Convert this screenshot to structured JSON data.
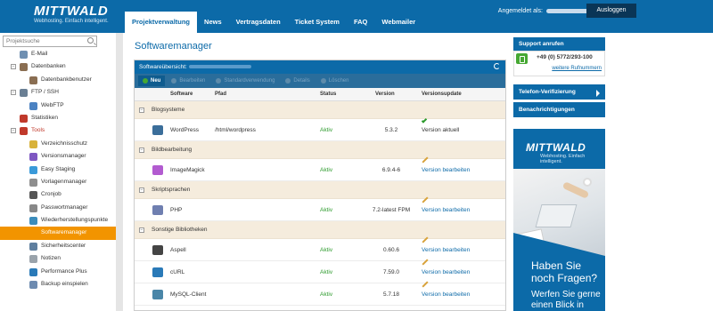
{
  "brand": {
    "name": "MITTWALD",
    "tagline": "Webhosting. Einfach intelligent."
  },
  "nav": {
    "items": [
      "Projektverwaltung",
      "News",
      "Vertragsdaten",
      "Ticket System",
      "FAQ",
      "Webmailer"
    ],
    "active": "Projektverwaltung"
  },
  "user": {
    "prefix": "Angemeldet als:",
    "logout": "Ausloggen"
  },
  "sidebar": {
    "search_placeholder": "Projektsuche",
    "items": [
      {
        "label": "E-Mail",
        "icon": "mail-icon"
      },
      {
        "label": "Datenbanken",
        "icon": "database-icon"
      },
      {
        "label": "Datenbankbenutzer",
        "icon": "database-user-icon"
      },
      {
        "label": "FTP / SSH",
        "icon": "server-icon"
      },
      {
        "label": "WebFTP",
        "icon": "webftp-icon"
      },
      {
        "label": "Statistiken",
        "icon": "statistics-icon"
      },
      {
        "label": "Tools",
        "icon": "tools-icon"
      },
      {
        "label": "Verzeichnisschutz",
        "icon": "key-icon"
      },
      {
        "label": "Versionsmanager",
        "icon": "version-icon"
      },
      {
        "label": "Easy Staging",
        "icon": "staging-icon"
      },
      {
        "label": "Vorlagenmanager",
        "icon": "template-icon"
      },
      {
        "label": "Cronjob",
        "icon": "clock-icon"
      },
      {
        "label": "Passwortmanager",
        "icon": "password-icon"
      },
      {
        "label": "Wiederherstellungspunkte",
        "icon": "restore-icon"
      },
      {
        "label": "Softwaremanager",
        "icon": "software-icon"
      },
      {
        "label": "Sicherheitscenter",
        "icon": "shield-icon"
      },
      {
        "label": "Notizen",
        "icon": "notes-icon"
      },
      {
        "label": "Performance Plus",
        "icon": "performance-icon"
      },
      {
        "label": "Backup einspielen",
        "icon": "backup-icon"
      }
    ]
  },
  "main": {
    "title": "Softwaremanager",
    "panel_title": "Softwareübersicht:",
    "toolbar": {
      "new": "Neu",
      "edit": "Bearbeiten",
      "default": "Standardverwendung",
      "details": "Details",
      "delete": "Löschen"
    },
    "columns": {
      "software": "Software",
      "path": "Pfad",
      "status": "Status",
      "version": "Version",
      "update": "Versionsupdate"
    },
    "groups": [
      {
        "name": "Blogsysteme",
        "rows": [
          {
            "software": "WordPress",
            "path": "/html/wordpress",
            "status": "Aktiv",
            "version": "5.3.2",
            "update": "Version aktuell",
            "update_type": "ok"
          }
        ]
      },
      {
        "name": "Bildbearbeitung",
        "rows": [
          {
            "software": "ImageMagick",
            "path": "",
            "status": "Aktiv",
            "version": "6.9.4-6",
            "update": "Version bearbeiten",
            "update_type": "edit"
          }
        ]
      },
      {
        "name": "Skriptsprachen",
        "rows": [
          {
            "software": "PHP",
            "path": "",
            "status": "Aktiv",
            "version": "7.2-latest FPM",
            "update": "Version bearbeiten",
            "update_type": "edit"
          }
        ]
      },
      {
        "name": "Sonstige Bibliotheken",
        "rows": [
          {
            "software": "Aspell",
            "path": "",
            "status": "Aktiv",
            "version": "0.60.6",
            "update": "Version bearbeiten",
            "update_type": "edit"
          },
          {
            "software": "cURL",
            "path": "",
            "status": "Aktiv",
            "version": "7.59.0",
            "update": "Version bearbeiten",
            "update_type": "edit"
          },
          {
            "software": "MySQL-Client",
            "path": "",
            "status": "Aktiv",
            "version": "5.7.18",
            "update": "Version bearbeiten",
            "update_type": "edit"
          }
        ]
      }
    ]
  },
  "right": {
    "support": "Support anrufen",
    "phone": "+49 (0) 5772/293-100",
    "more_numbers": "weitere Rufnummern",
    "verification": "Telefon-Verifizierung",
    "notifications": "Benachrichtigungen",
    "ad": {
      "logo": "MITTWALD",
      "tagline": "Webhosting. Einfach intelligent.",
      "headline": "Haben Sie noch Fragen?",
      "body": "Werfen Sie gerne einen Blick in"
    }
  },
  "colors": {
    "primary": "#0c6aa8",
    "accent": "#f29400",
    "active_status": "#2c9a2c",
    "group_bg": "#f5ecdd"
  }
}
